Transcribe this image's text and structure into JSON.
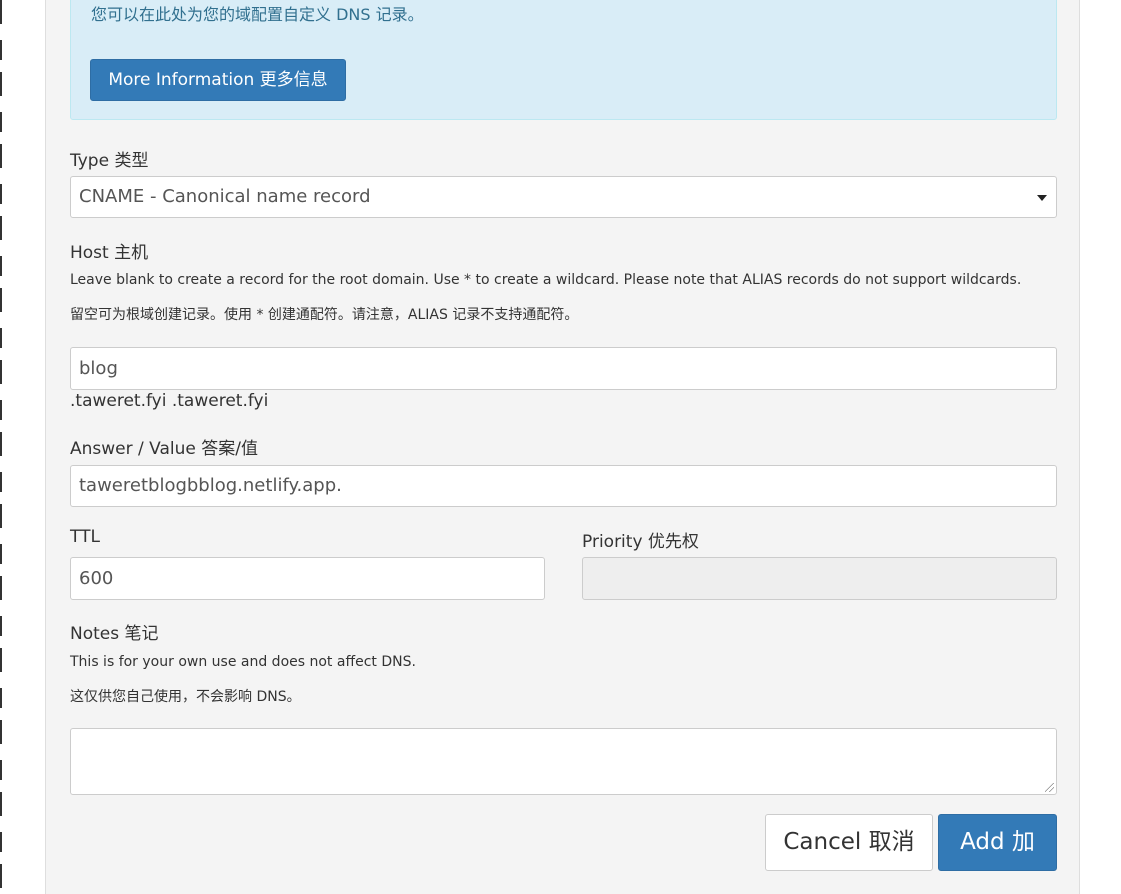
{
  "info": {
    "text": "您可以在此处为您的域配置自定义 DNS 记录。",
    "more_button": "More Information  更多信息"
  },
  "type": {
    "label": "Type  类型",
    "selected": "CNAME - Canonical name record"
  },
  "host": {
    "label": "Host  主机",
    "help_en": "Leave blank to create a record for the root domain. Use * to create a wildcard. Please note that ALIAS records do not support wildcards.",
    "help_zh": "留空可为根域创建记录。使用 * 创建通配符。请注意，ALIAS 记录不支持通配符。",
    "value": "blog",
    "suffix": ".taweret.fyi  .taweret.fyi"
  },
  "answer": {
    "label": "Answer / Value  答案/值",
    "value": "taweretblogbblog.netlify.app."
  },
  "ttl": {
    "label": "TTL",
    "value": "600"
  },
  "priority": {
    "label": "Priority  优先权",
    "value": ""
  },
  "notes": {
    "label": "Notes  笔记",
    "help_en": "This is for your own use and does not affect DNS.",
    "help_zh": "这仅供您自己使用，不会影响 DNS。",
    "value": ""
  },
  "actions": {
    "cancel": "Cancel  取消",
    "add": "Add  加"
  },
  "colors": {
    "primary": "#337ab7",
    "info_bg": "#d9edf7",
    "info_text": "#31708f",
    "panel_bg": "#f4f4f4"
  }
}
